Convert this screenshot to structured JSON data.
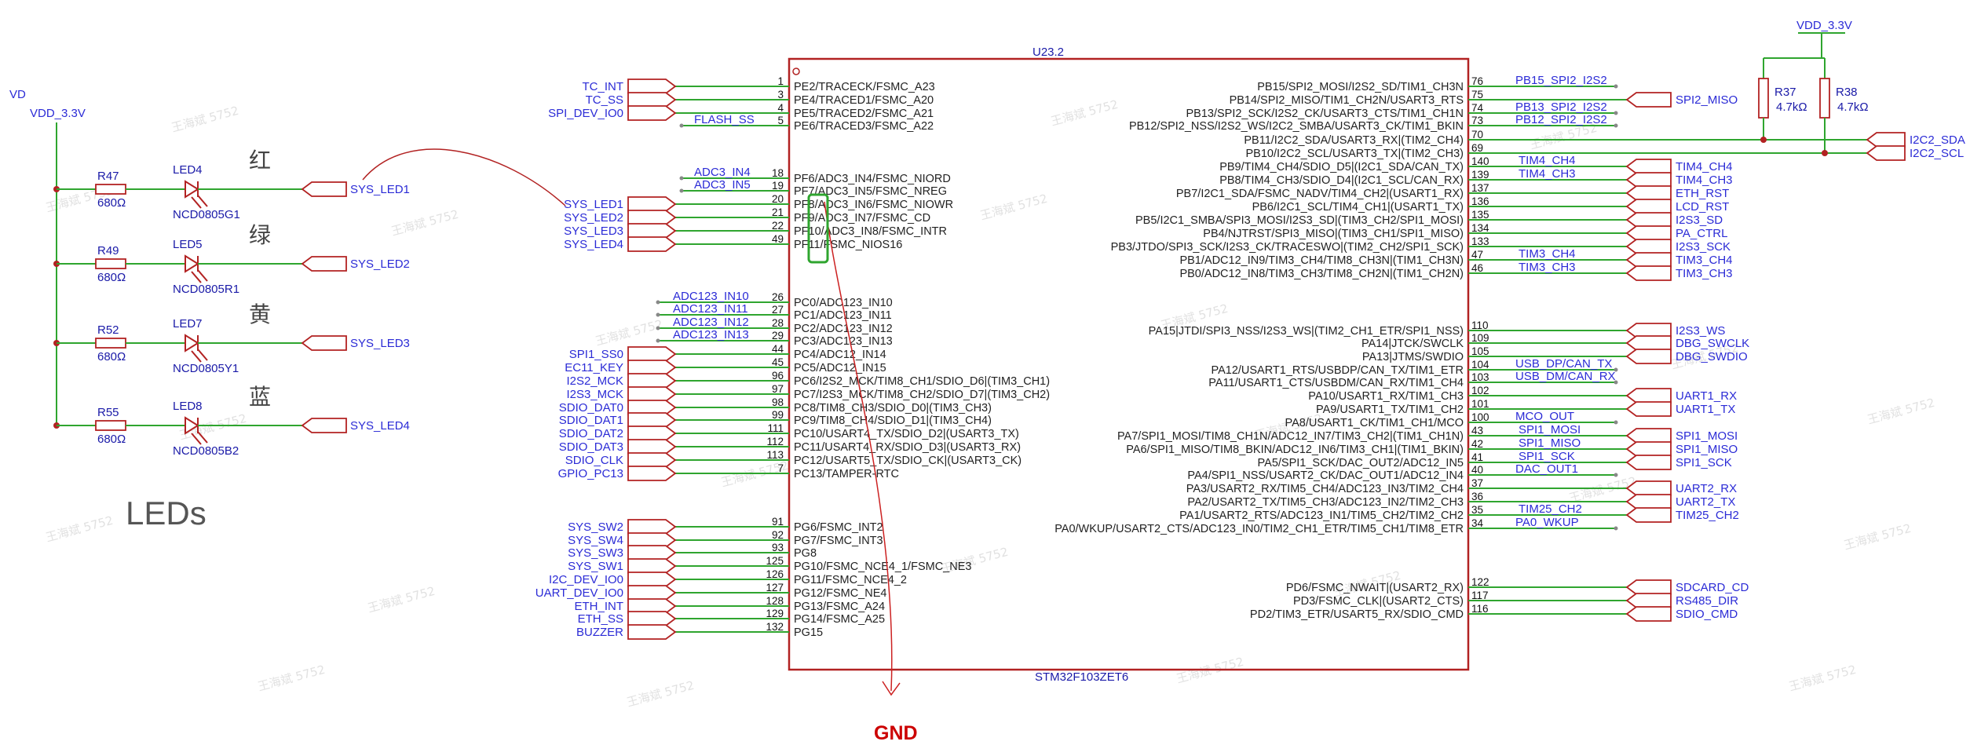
{
  "chip": {
    "ref": "U23.2",
    "part": "STM32F103ZET6"
  },
  "power": {
    "vdd_left_top": "VD",
    "vdd_left": "VDD_3.3V",
    "vdd_right": "VDD_3.3V"
  },
  "gnd_label": "GND",
  "leds_title": "LEDs",
  "leds": [
    {
      "res": "R47",
      "res_val": "680Ω",
      "led": "LED4",
      "part": "NCD0805G1",
      "color": "红",
      "port": "SYS_LED1"
    },
    {
      "res": "R49",
      "res_val": "680Ω",
      "led": "LED5",
      "part": "NCD0805R1",
      "color": "绿",
      "port": "SYS_LED2"
    },
    {
      "res": "R52",
      "res_val": "680Ω",
      "led": "LED7",
      "part": "NCD0805Y1",
      "color": "黄",
      "port": "SYS_LED3"
    },
    {
      "res": "R55",
      "res_val": "680Ω",
      "led": "LED8",
      "part": "NCD0805B2",
      "color": "蓝",
      "port": "SYS_LED4"
    }
  ],
  "pullups": [
    {
      "ref": "R37",
      "val": "4.7kΩ"
    },
    {
      "ref": "R38",
      "val": "4.7kΩ"
    }
  ],
  "left_pins": [
    {
      "num": "1",
      "name": "PE2/TRACECK/FSMC_A23",
      "net": "TC_INT",
      "kind": "port"
    },
    {
      "num": "3",
      "name": "PE4/TRACED1/FSMC_A20",
      "net": "TC_SS",
      "kind": "port"
    },
    {
      "num": "4",
      "name": "PE5/TRACED2/FSMC_A21",
      "net": "SPI_DEV_IO0",
      "kind": "port"
    },
    {
      "num": "5",
      "name": "PE6/TRACED3/FSMC_A22",
      "net": "FLASH_SS",
      "kind": "label"
    },
    {
      "num": "18",
      "name": "PF6/ADC3_IN4/FSMC_NIORD",
      "net": "ADC3_IN4",
      "kind": "label"
    },
    {
      "num": "19",
      "name": "PF7/ADC3_IN5/FSMC_NREG",
      "net": "ADC3_IN5",
      "kind": "label"
    },
    {
      "num": "20",
      "name": "PF8/ADC3_IN6/FSMC_NIOWR",
      "net": "SYS_LED1",
      "kind": "port"
    },
    {
      "num": "21",
      "name": "PF9/ADC3_IN7/FSMC_CD",
      "net": "SYS_LED2",
      "kind": "port"
    },
    {
      "num": "22",
      "name": "PF10/ADC3_IN8/FSMC_INTR",
      "net": "SYS_LED3",
      "kind": "port"
    },
    {
      "num": "49",
      "name": "PF11/FSMC_NIOS16",
      "net": "SYS_LED4",
      "kind": "port"
    },
    {
      "num": "26",
      "name": "PC0/ADC123_IN10",
      "net": "ADC123_IN10",
      "kind": "label"
    },
    {
      "num": "27",
      "name": "PC1/ADC123_IN11",
      "net": "ADC123_IN11",
      "kind": "label"
    },
    {
      "num": "28",
      "name": "PC2/ADC123_IN12",
      "net": "ADC123_IN12",
      "kind": "label"
    },
    {
      "num": "29",
      "name": "PC3/ADC123_IN13",
      "net": "ADC123_IN13",
      "kind": "label"
    },
    {
      "num": "44",
      "name": "PC4/ADC12_IN14",
      "net": "SPI1_SS0",
      "kind": "port"
    },
    {
      "num": "45",
      "name": "PC5/ADC12_IN15",
      "net": "EC11_KEY",
      "kind": "port"
    },
    {
      "num": "96",
      "name": "PC6/I2S2_MCK/TIM8_CH1/SDIO_D6|(TIM3_CH1)",
      "net": "I2S2_MCK",
      "kind": "port"
    },
    {
      "num": "97",
      "name": "PC7/I2S3_MCK/TIM8_CH2/SDIO_D7|(TIM3_CH2)",
      "net": "I2S3_MCK",
      "kind": "port"
    },
    {
      "num": "98",
      "name": "PC8/TIM8_CH3/SDIO_D0|(TIM3_CH3)",
      "net": "SDIO_DAT0",
      "kind": "port"
    },
    {
      "num": "99",
      "name": "PC9/TIM8_CH4/SDIO_D1|(TIM3_CH4)",
      "net": "SDIO_DAT1",
      "kind": "port"
    },
    {
      "num": "111",
      "name": "PC10/USART4_TX/SDIO_D2|(USART3_TX)",
      "net": "SDIO_DAT2",
      "kind": "port"
    },
    {
      "num": "112",
      "name": "PC11/USART4_RX/SDIO_D3|(USART3_RX)",
      "net": "SDIO_DAT3",
      "kind": "port"
    },
    {
      "num": "113",
      "name": "PC12/USART5_TX/SDIO_CK|(USART3_CK)",
      "net": "SDIO_CLK",
      "kind": "port"
    },
    {
      "num": "7",
      "name": "PC13/TAMPER-RTC",
      "net": "GPIO_PC13",
      "kind": "port"
    },
    {
      "num": "91",
      "name": "PG6/FSMC_INT2",
      "net": "SYS_SW2",
      "kind": "port"
    },
    {
      "num": "92",
      "name": "PG7/FSMC_INT3",
      "net": "SYS_SW4",
      "kind": "port"
    },
    {
      "num": "93",
      "name": "PG8",
      "net": "SYS_SW3",
      "kind": "port"
    },
    {
      "num": "125",
      "name": "PG10/FSMC_NCE4_1/FSMC_NE3",
      "net": "SYS_SW1",
      "kind": "port"
    },
    {
      "num": "126",
      "name": "PG11/FSMC_NCE4_2",
      "net": "I2C_DEV_IO0",
      "kind": "port"
    },
    {
      "num": "127",
      "name": "PG12/FSMC_NE4",
      "net": "UART_DEV_IO0",
      "kind": "port"
    },
    {
      "num": "128",
      "name": "PG13/FSMC_A24",
      "net": "ETH_INT",
      "kind": "port"
    },
    {
      "num": "129",
      "name": "PG14/FSMC_A25",
      "net": "ETH_SS",
      "kind": "port"
    },
    {
      "num": "132",
      "name": "PG15",
      "net": "BUZZER",
      "kind": "port"
    }
  ],
  "right_pins": [
    {
      "num": "76",
      "name": "PB15/SPI2_MOSI/I2S2_SD/TIM1_CH3N",
      "net": "PB15_SPI2_I2S2",
      "kind": "label",
      "ext": ""
    },
    {
      "num": "75",
      "name": "PB14/SPI2_MISO/TIM1_CH2N/USART3_RTS",
      "net": "",
      "kind": "port",
      "ext": "SPI2_MISO"
    },
    {
      "num": "74",
      "name": "PB13/SPI2_SCK/I2S2_CK/USART3_CTS/TIM1_CH1N",
      "net": "PB13_SPI2_I2S2",
      "kind": "label",
      "ext": ""
    },
    {
      "num": "73",
      "name": "PB12/SPI2_NSS/I2S2_WS/I2C2_SMBA/USART3_CK/TIM1_BKIN",
      "net": "PB12_SPI2_I2S2",
      "kind": "label",
      "ext": ""
    },
    {
      "num": "70",
      "name": "PB11/I2C2_SDA/USART3_RX|(TIM2_CH4)",
      "net": "",
      "kind": "bus",
      "ext": "I2C2_SDA"
    },
    {
      "num": "69",
      "name": "PB10/I2C2_SCL/USART3_TX|(TIM2_CH3)",
      "net": "",
      "kind": "bus",
      "ext": "I2C2_SCL"
    },
    {
      "num": "140",
      "name": "PB9/TIM4_CH4/SDIO_D5|(I2C1_SDA/CAN_TX)",
      "net": "TIM4_CH4",
      "kind": "port",
      "ext": "TIM4_CH4"
    },
    {
      "num": "139",
      "name": "PB8/TIM4_CH3/SDIO_D4|(I2C1_SCL/CAN_RX)",
      "net": "TIM4_CH3",
      "kind": "port",
      "ext": "TIM4_CH3"
    },
    {
      "num": "137",
      "name": "PB7/I2C1_SDA/FSMC_NADV/TIM4_CH2|(USART1_RX)",
      "net": "",
      "kind": "port",
      "ext": "ETH_RST"
    },
    {
      "num": "136",
      "name": "PB6/I2C1_SCL/TIM4_CH1|(USART1_TX)",
      "net": "",
      "kind": "port",
      "ext": "LCD_RST"
    },
    {
      "num": "135",
      "name": "PB5/I2C1_SMBA/SPI3_MOSI/I2S3_SD|(TIM3_CH2/SPI1_MOSI)",
      "net": "",
      "kind": "port",
      "ext": "I2S3_SD"
    },
    {
      "num": "134",
      "name": "PB4/NJTRST/SPI3_MISO|(TIM3_CH1/SPI1_MISO)",
      "net": "",
      "kind": "port",
      "ext": "PA_CTRL"
    },
    {
      "num": "133",
      "name": "PB3/JTDO/SPI3_SCK/I2S3_CK/TRACESWO|(TIM2_CH2/SPI1_SCK)",
      "net": "",
      "kind": "port",
      "ext": "I2S3_SCK"
    },
    {
      "num": "47",
      "name": "PB1/ADC12_IN9/TIM3_CH4/TIM8_CH3N|(TIM1_CH3N)",
      "net": "TIM3_CH4",
      "kind": "port",
      "ext": "TIM3_CH4"
    },
    {
      "num": "46",
      "name": "PB0/ADC12_IN8/TIM3_CH3/TIM8_CH2N|(TIM1_CH2N)",
      "net": "TIM3_CH3",
      "kind": "port",
      "ext": "TIM3_CH3"
    },
    {
      "num": "110",
      "name": "PA15|JTDI/SPI3_NSS/I2S3_WS|(TIM2_CH1_ETR/SPI1_NSS)",
      "net": "",
      "kind": "port",
      "ext": "I2S3_WS"
    },
    {
      "num": "109",
      "name": "PA14|JTCK/SWCLK",
      "net": "",
      "kind": "port",
      "ext": "DBG_SWCLK"
    },
    {
      "num": "105",
      "name": "PA13|JTMS/SWDIO",
      "net": "",
      "kind": "port",
      "ext": "DBG_SWDIO"
    },
    {
      "num": "104",
      "name": "PA12/USART1_RTS/USBDP/CAN_TX/TIM1_ETR",
      "net": "USB_DP/CAN_TX",
      "kind": "label",
      "ext": ""
    },
    {
      "num": "103",
      "name": "PA11/USART1_CTS/USBDM/CAN_RX/TIM1_CH4",
      "net": "USB_DM/CAN_RX",
      "kind": "label",
      "ext": ""
    },
    {
      "num": "102",
      "name": "PA10/USART1_RX/TIM1_CH3",
      "net": "",
      "kind": "port",
      "ext": "UART1_RX"
    },
    {
      "num": "101",
      "name": "PA9/USART1_TX/TIM1_CH2",
      "net": "",
      "kind": "port",
      "ext": "UART1_TX"
    },
    {
      "num": "100",
      "name": "PA8/USART1_CK/TIM1_CH1/MCO",
      "net": "MCO_OUT",
      "kind": "label",
      "ext": ""
    },
    {
      "num": "43",
      "name": "PA7/SPI1_MOSI/TIM8_CH1N/ADC12_IN7/TIM3_CH2|(TIM1_CH1N)",
      "net": "SPI1_MOSI",
      "kind": "port",
      "ext": "SPI1_MOSI"
    },
    {
      "num": "42",
      "name": "PA6/SPI1_MISO/TIM8_BKIN/ADC12_IN6/TIM3_CH1|(TIM1_BKIN)",
      "net": "SPI1_MISO",
      "kind": "port",
      "ext": "SPI1_MISO"
    },
    {
      "num": "41",
      "name": "PA5/SPI1_SCK/DAC_OUT2/ADC12_IN5",
      "net": "SPI1_SCK",
      "kind": "port",
      "ext": "SPI1_SCK"
    },
    {
      "num": "40",
      "name": "PA4/SPI1_NSS/USART2_CK/DAC_OUT1/ADC12_IN4",
      "net": "DAC_OUT1",
      "kind": "label",
      "ext": ""
    },
    {
      "num": "37",
      "name": "PA3/USART2_RX/TIM5_CH4/ADC123_IN3/TIM2_CH4",
      "net": "",
      "kind": "port",
      "ext": "UART2_RX"
    },
    {
      "num": "36",
      "name": "PA2/USART2_TX/TIM5_CH3/ADC123_IN2/TIM2_CH3",
      "net": "",
      "kind": "port",
      "ext": "UART2_TX"
    },
    {
      "num": "35",
      "name": "PA1/USART2_RTS/ADC123_IN1/TIM5_CH2/TIM2_CH2",
      "net": "TIM25_CH2",
      "kind": "port",
      "ext": "TIM25_CH2"
    },
    {
      "num": "34",
      "name": "PA0/WKUP/USART2_CTS/ADC123_IN0/TIM2_CH1_ETR/TIM5_CH1/TIM8_ETR",
      "net": "PA0_WKUP",
      "kind": "label",
      "ext": ""
    },
    {
      "num": "122",
      "name": "PD6/FSMC_NWAIT|(USART2_RX)",
      "net": "",
      "kind": "port",
      "ext": "SDCARD_CD"
    },
    {
      "num": "117",
      "name": "PD3/FSMC_CLK|(USART2_CTS)",
      "net": "",
      "kind": "port",
      "ext": "RS485_DIR"
    },
    {
      "num": "116",
      "name": "PD2/TIM3_ETR/USART5_RX/SDIO_CMD",
      "net": "",
      "kind": "port",
      "ext": "SDIO_CMD"
    }
  ],
  "watermark": "王海斌 5752"
}
